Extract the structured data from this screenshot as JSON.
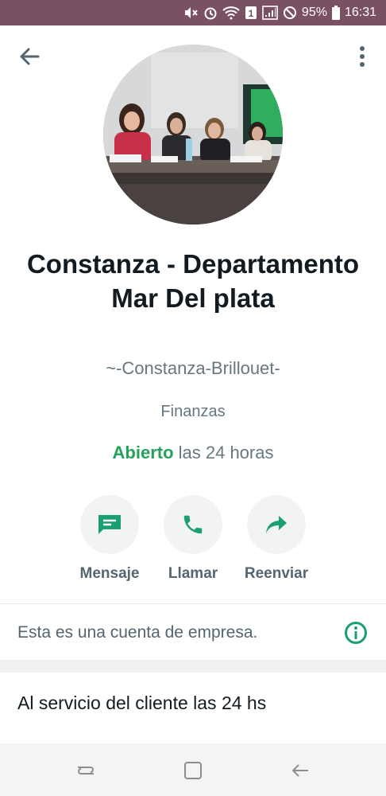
{
  "status_bar": {
    "battery": "95%",
    "time": "16:31",
    "sim_badge": "1"
  },
  "profile": {
    "name": "Constanza - Departamento Mar Del plata",
    "pushname": "~-Constanza-Brillouet-",
    "category": "Finanzas",
    "hours_status": "Abierto",
    "hours_text": " las 24 horas"
  },
  "actions": [
    {
      "label": "Mensaje",
      "icon": "message-icon"
    },
    {
      "label": "Llamar",
      "icon": "phone-icon"
    },
    {
      "label": "Reenviar",
      "icon": "forward-icon"
    }
  ],
  "business_notice": "Esta es una cuenta de empresa.",
  "description": "Al servicio del cliente las 24 hs",
  "colors": {
    "accent": "#25a15a",
    "icon_green": "#1a9e74",
    "status_bar": "#7a5163"
  }
}
